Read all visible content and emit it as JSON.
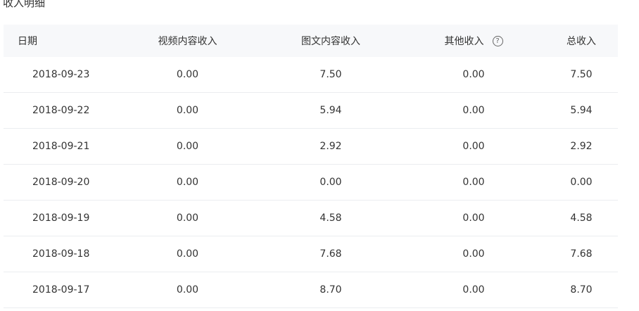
{
  "section": {
    "title": "收入明细"
  },
  "table": {
    "headers": {
      "date": "日期",
      "video": "视频内容收入",
      "article": "图文内容收入",
      "other": "其他收入",
      "total": "总收入"
    },
    "rows": [
      {
        "date": "2018-09-23",
        "video": "0.00",
        "article": "7.50",
        "other": "0.00",
        "total": "7.50"
      },
      {
        "date": "2018-09-22",
        "video": "0.00",
        "article": "5.94",
        "other": "0.00",
        "total": "5.94"
      },
      {
        "date": "2018-09-21",
        "video": "0.00",
        "article": "2.92",
        "other": "0.00",
        "total": "2.92"
      },
      {
        "date": "2018-09-20",
        "video": "0.00",
        "article": "0.00",
        "other": "0.00",
        "total": "0.00"
      },
      {
        "date": "2018-09-19",
        "video": "0.00",
        "article": "4.58",
        "other": "0.00",
        "total": "4.58"
      },
      {
        "date": "2018-09-18",
        "video": "0.00",
        "article": "7.68",
        "other": "0.00",
        "total": "7.68"
      },
      {
        "date": "2018-09-17",
        "video": "0.00",
        "article": "8.70",
        "other": "0.00",
        "total": "8.70"
      }
    ]
  },
  "icons": {
    "help": "question-circle-icon"
  },
  "colors": {
    "header_background": "#f7f8fa",
    "row_divider": "#ebedf0",
    "text": "#333333"
  }
}
